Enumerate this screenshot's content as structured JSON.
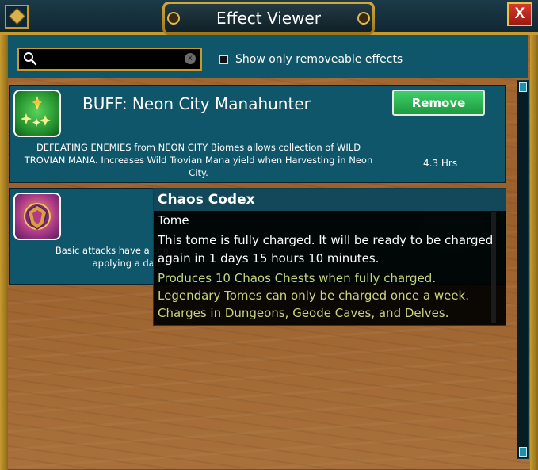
{
  "window": {
    "title": "Effect Viewer",
    "close_label": "X"
  },
  "toolbar": {
    "search": {
      "value": "",
      "placeholder": ""
    },
    "clear_label": "x",
    "filter_label": "Show only removeable effects",
    "filter_checked": false
  },
  "effects": [
    {
      "name": "BUFF: Neon City Manahunter",
      "description": "DEFEATING ENEMIES from NEON CITY Biomes allows collection of WILD TROVIAN MANA. Increases Wild Trovian Mana yield when Harvesting in Neon City.",
      "remove_label": "Remove",
      "duration": "4.3 Hrs",
      "icon": "mana-sparkle-icon"
    },
    {
      "name": "",
      "description_visible": "Basic attacks have a cha\napplying a dama",
      "icon": "chaos-emblem-icon"
    }
  ],
  "tooltip": {
    "title": "Chaos Codex",
    "type": "Tome",
    "line1": "This tome is fully charged. It will be ready to be charged",
    "line2_prefix": "again in 1 days ",
    "line2_time": "15 hours 10 minutes",
    "line2_suffix": ".",
    "info": [
      "Produces 10 Chaos Chests when fully charged.",
      "Legendary Tomes can only be charged once a week.",
      "Charges in Dungeons, Geode Caves, and Delves."
    ]
  },
  "colors": {
    "panel": "#10566a",
    "gold_frame": "#c79a2e",
    "remove_green": "#2db456",
    "close_red": "#c0271b",
    "tooltip_info": "#c6d57a"
  }
}
